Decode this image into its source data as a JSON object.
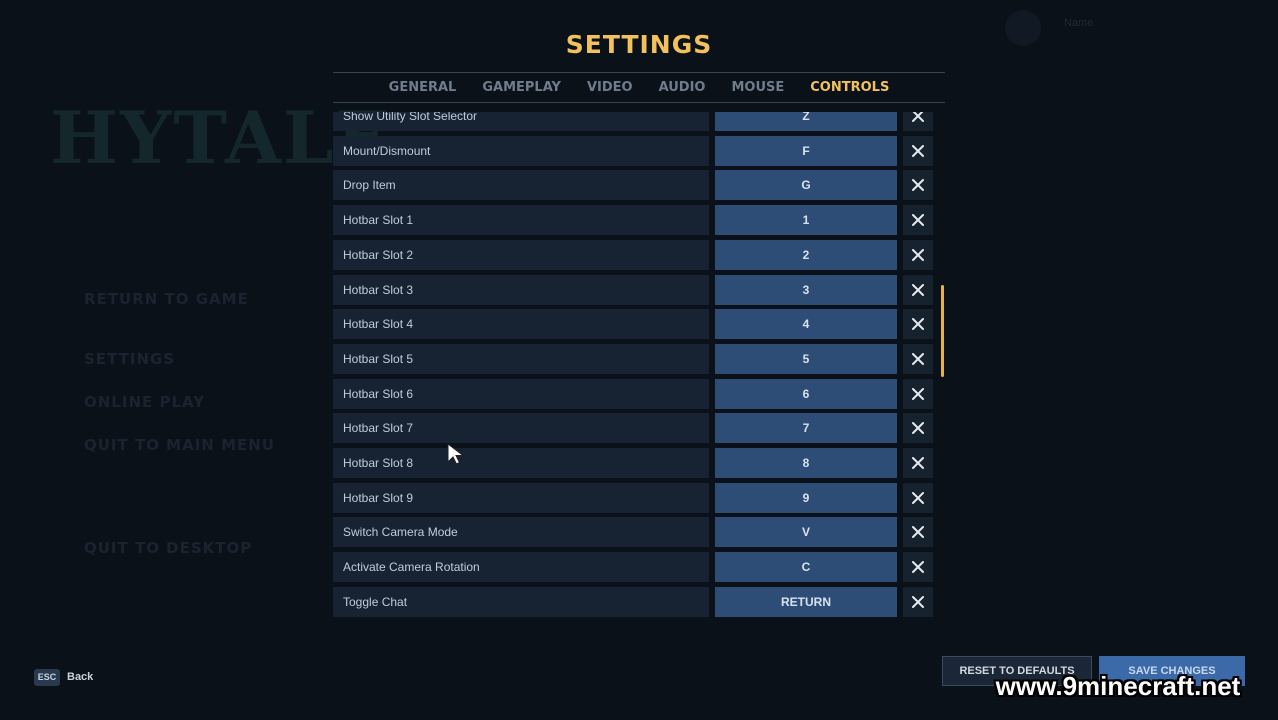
{
  "background": {
    "logo_text": "HYTALE",
    "menu_items": [
      "RETURN TO GAME",
      "SETTINGS",
      "ONLINE PLAY",
      "QUIT TO MAIN MENU",
      "QUIT TO DESKTOP"
    ],
    "profile_name": "Name"
  },
  "settings": {
    "title": "SETTINGS",
    "tabs": [
      {
        "label": "GENERAL",
        "active": false
      },
      {
        "label": "GAMEPLAY",
        "active": false
      },
      {
        "label": "VIDEO",
        "active": false
      },
      {
        "label": "AUDIO",
        "active": false
      },
      {
        "label": "MOUSE",
        "active": false
      },
      {
        "label": "CONTROLS",
        "active": true
      }
    ],
    "bindings": [
      {
        "action": "Show Utility Slot Selector",
        "key": "Z"
      },
      {
        "action": "Mount/Dismount",
        "key": "F"
      },
      {
        "action": "Drop Item",
        "key": "G"
      },
      {
        "action": "Hotbar Slot 1",
        "key": "1"
      },
      {
        "action": "Hotbar Slot 2",
        "key": "2"
      },
      {
        "action": "Hotbar Slot 3",
        "key": "3"
      },
      {
        "action": "Hotbar Slot 4",
        "key": "4"
      },
      {
        "action": "Hotbar Slot 5",
        "key": "5"
      },
      {
        "action": "Hotbar Slot 6",
        "key": "6"
      },
      {
        "action": "Hotbar Slot 7",
        "key": "7"
      },
      {
        "action": "Hotbar Slot 8",
        "key": "8"
      },
      {
        "action": "Hotbar Slot 9",
        "key": "9"
      },
      {
        "action": "Switch Camera Mode",
        "key": "V"
      },
      {
        "action": "Activate Camera Rotation",
        "key": "C"
      },
      {
        "action": "Toggle Chat",
        "key": "RETURN"
      }
    ],
    "clear_icon": "close-icon"
  },
  "footer": {
    "esc_key": "ESC",
    "back_label": "Back",
    "reset_label": "RESET TO DEFAULTS",
    "save_label": "SAVE CHANGES"
  },
  "watermark": "www.9minecraft.net",
  "colors": {
    "accent": "#f2c15b",
    "key_button": "#2e4d76",
    "row_bg": "#172333",
    "save_button": "#3c6aa8"
  }
}
